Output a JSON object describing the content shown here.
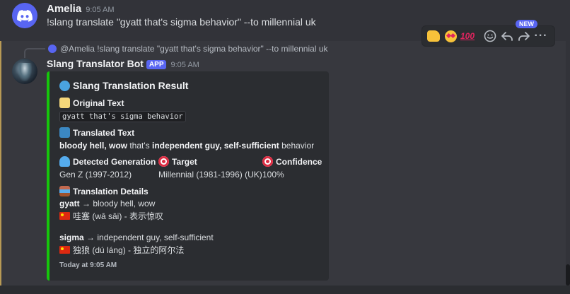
{
  "message1": {
    "author": "Amelia",
    "timestamp": "9:05 AM",
    "text": "!slang translate \"gyatt that's sigma behavior\" --to millennial uk"
  },
  "reply": {
    "text": "@Amelia !slang translate \"gyatt that's sigma behavior\" --to millennial uk"
  },
  "bot_message": {
    "author": "Slang Translator Bot",
    "badge": "APP",
    "timestamp": "9:05 AM"
  },
  "embed": {
    "accent_color": "#16c60c",
    "title": "Slang Translation Result",
    "original_label": "Original Text",
    "original_value": "gyatt that's sigma behavior",
    "translated_label": "Translated Text",
    "translated": {
      "p1": "bloody hell, wow",
      "p2": " that's ",
      "p3": "independent guy, self-sufficient",
      "p4": " behavior"
    },
    "detected_label": "Detected Generation",
    "detected_value": "Gen Z (1997-2012)",
    "target_label": "Target",
    "target_value": "Millennial (1981-1996) (UK)",
    "confidence_label": "Confidence",
    "confidence_value": "100%",
    "details_label": "Translation Details",
    "detail1": {
      "term": "gyatt",
      "arrow": " → ",
      "meaning": "bloody hell, wow",
      "chinese": "哇塞 (wā sāi) - 表示惊叹"
    },
    "detail2": {
      "term": "sigma",
      "arrow": " → ",
      "meaning": "independent guy, self-sufficient",
      "chinese": "独狼 (dú láng) - 独立的阿尔法"
    },
    "footer": "Today at 9:05 AM"
  },
  "toolbar": {
    "new_badge": "NEW",
    "more": "···"
  }
}
